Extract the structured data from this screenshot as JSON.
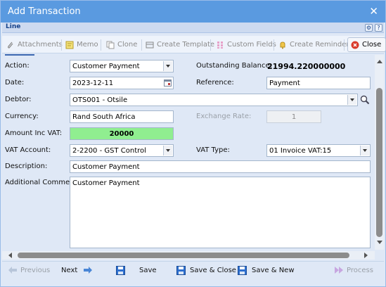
{
  "window": {
    "title": "Add Transaction"
  },
  "panel": {
    "label": "Line"
  },
  "toolbar": {
    "attachments": "Attachments",
    "memo": "Memo",
    "clone": "Clone",
    "create_template": "Create Template",
    "custom_fields": "Custom Fields",
    "create_reminder": "Create Reminder",
    "close": "Close"
  },
  "form": {
    "action": {
      "label": "Action:",
      "value": "Customer Payment"
    },
    "date": {
      "label": "Date:",
      "value": "2023-12-11"
    },
    "debtor": {
      "label": "Debtor:",
      "value": "OTS001 - Otsile"
    },
    "currency": {
      "label": "Currency:",
      "value": "Rand South Africa"
    },
    "amount": {
      "label": "Amount Inc VAT:",
      "value": "20000"
    },
    "vat_account": {
      "label": "VAT Account:",
      "value": "2-2200 - GST Control"
    },
    "description": {
      "label": "Description:",
      "value": "Customer Payment"
    },
    "additional_comment": {
      "label": "Additional Comment:",
      "value": "Customer Payment"
    },
    "outstanding_balance": {
      "label": "Outstanding Balance:",
      "value": "21994.220000000"
    },
    "reference": {
      "label": "Reference:",
      "value": "Payment"
    },
    "exchange_rate": {
      "label": "Exchange Rate:",
      "value": "1"
    },
    "vat_type": {
      "label": "VAT Type:",
      "value": "01 Invoice VAT:15"
    }
  },
  "footer": {
    "previous": "Previous",
    "next": "Next",
    "save": "Save",
    "save_close": "Save & Close",
    "save_new": "Save & New",
    "process": "Process"
  },
  "colors": {
    "title_bar": "#5a9ae0",
    "amount_bg": "#90ee90",
    "body_bg": "#dfe8f6"
  }
}
